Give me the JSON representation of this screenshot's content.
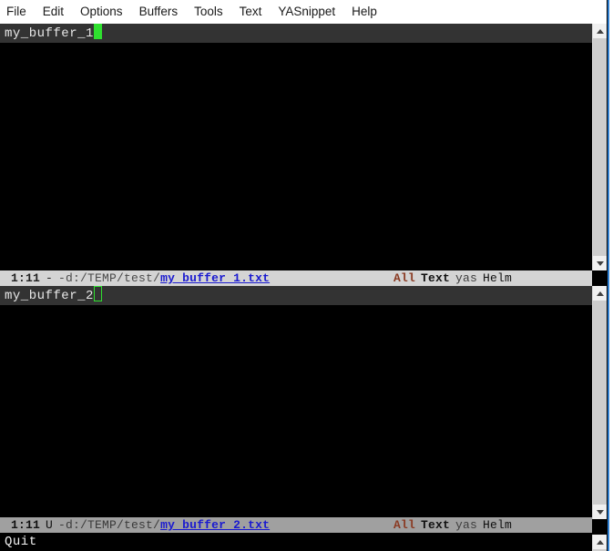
{
  "menubar": {
    "items": [
      {
        "label": "File"
      },
      {
        "label": "Edit"
      },
      {
        "label": "Options"
      },
      {
        "label": "Buffers"
      },
      {
        "label": "Tools"
      },
      {
        "label": "Text"
      },
      {
        "label": "YASnippet"
      },
      {
        "label": "Help"
      }
    ]
  },
  "windows": [
    {
      "buffer_text": "my_buffer_1",
      "cursor_style": "block",
      "mode_line": {
        "position": "1:11",
        "modified_flag": "-",
        "coding_prefix": "-d:",
        "directory": "/TEMP/test/",
        "filename": "my_buffer_1.txt",
        "scroll_state": "All",
        "major_mode": "Text",
        "minor_modes": "yas",
        "helm": "Helm"
      }
    },
    {
      "buffer_text": "my_buffer_2",
      "cursor_style": "hollow",
      "mode_line": {
        "position": "1:11",
        "modified_flag": "U",
        "coding_prefix": "-d:",
        "directory": "/TEMP/test/",
        "filename": "my_buffer_2.txt",
        "scroll_state": "All",
        "major_mode": "Text",
        "minor_modes": "yas",
        "helm": "Helm"
      }
    }
  ],
  "echo_area": {
    "message": "Quit"
  },
  "scrollbars": {
    "up_arrow": "chevron-up",
    "down_arrow": "chevron-down"
  },
  "colors": {
    "cursor": "#2fe02f",
    "buffer_background": "#000000",
    "header_row": "#333333",
    "mode_line_inactive": "#d4d4d4",
    "mode_line_active": "#a0a0a0",
    "filename_link": "#1a1ad0",
    "scroll_state": "#8a3a22",
    "frame_border": "#2f7fd0"
  }
}
